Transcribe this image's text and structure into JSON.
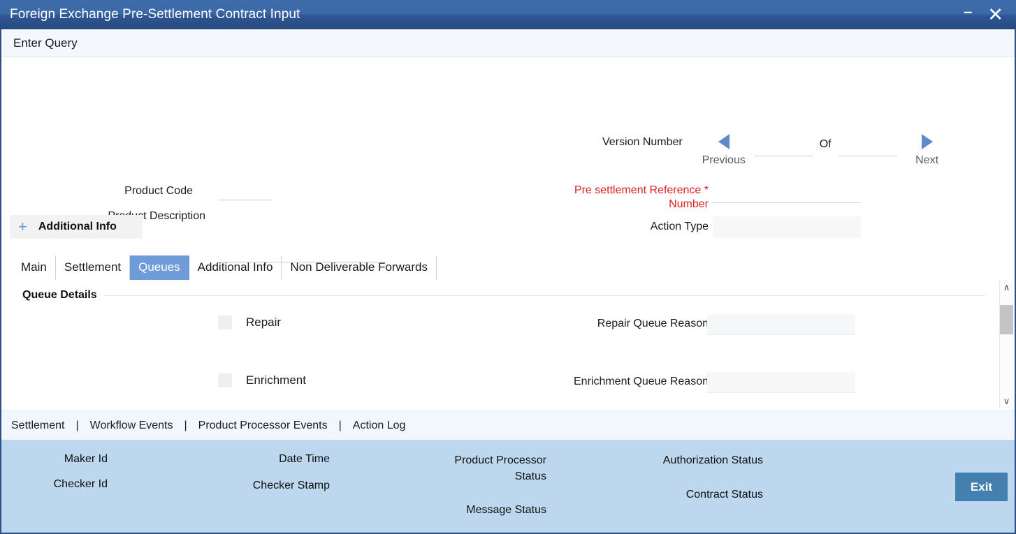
{
  "window": {
    "title": "Foreign Exchange Pre-Settlement Contract Input",
    "minimize_icon": "minimize-icon",
    "minimize_glyph": "–",
    "close_icon": "close-icon",
    "close_glyph": "✕",
    "titlebar_color": "#35609e"
  },
  "subbar": {
    "enter_query_label": "Enter Query"
  },
  "header": {
    "version": {
      "label": "Version Number",
      "previous_caption": "Previous",
      "next_caption": "Next",
      "of_label": "Of",
      "current_value": "",
      "total_value": "",
      "arrow_color": "#5d8ac9"
    },
    "fields": {
      "product_code_label": "Product Code",
      "product_code_value": "",
      "product_description_label": "Product Description",
      "product_description_value": "",
      "pre_settlement_ref_label": "Pre settlement Reference",
      "pre_settlement_ref_label2": "Number",
      "pre_settlement_ref_required": "*",
      "pre_settlement_ref_value": "",
      "action_type_label": "Action Type",
      "action_type_value": "",
      "required_color": "#e02121"
    }
  },
  "accordion": {
    "plus_glyph": "+",
    "label": "Additional Info"
  },
  "tabs": {
    "items": [
      {
        "label": "Main",
        "active": false
      },
      {
        "label": "Settlement",
        "active": false
      },
      {
        "label": "Queues",
        "active": true
      },
      {
        "label": "Additional Info",
        "active": false
      },
      {
        "label": "Non Deliverable Forwards",
        "active": false
      }
    ],
    "active_color": "#6f9bd8"
  },
  "panel": {
    "section_title": "Queue Details",
    "repair_checkbox_label": "Repair",
    "repair_checked": false,
    "enrichment_checkbox_label": "Enrichment",
    "enrichment_checked": false,
    "repair_queue_reason_label": "Repair Queue Reason",
    "repair_queue_reason_value": "",
    "enrichment_queue_reason_label": "Enrichment Queue Reason",
    "enrichment_queue_reason_value": ""
  },
  "scrollbar": {
    "up_glyph": "∧",
    "down_glyph": "∨"
  },
  "links": {
    "separator": "|",
    "items": [
      {
        "label": "Settlement"
      },
      {
        "label": "Workflow Events"
      },
      {
        "label": "Product Processor Events"
      },
      {
        "label": "Action Log"
      }
    ]
  },
  "footer": {
    "background_color": "#bcd7ee",
    "maker_id_label": "Maker Id",
    "checker_id_label": "Checker Id",
    "date_time_label": "Date Time",
    "checker_stamp_label": "Checker Stamp",
    "product_processor_status_label": "Product Processor Status",
    "message_status_label": "Message Status",
    "authorization_status_label": "Authorization Status",
    "contract_status_label": "Contract Status",
    "exit_button_label": "Exit",
    "exit_button_color": "#4380b0"
  }
}
